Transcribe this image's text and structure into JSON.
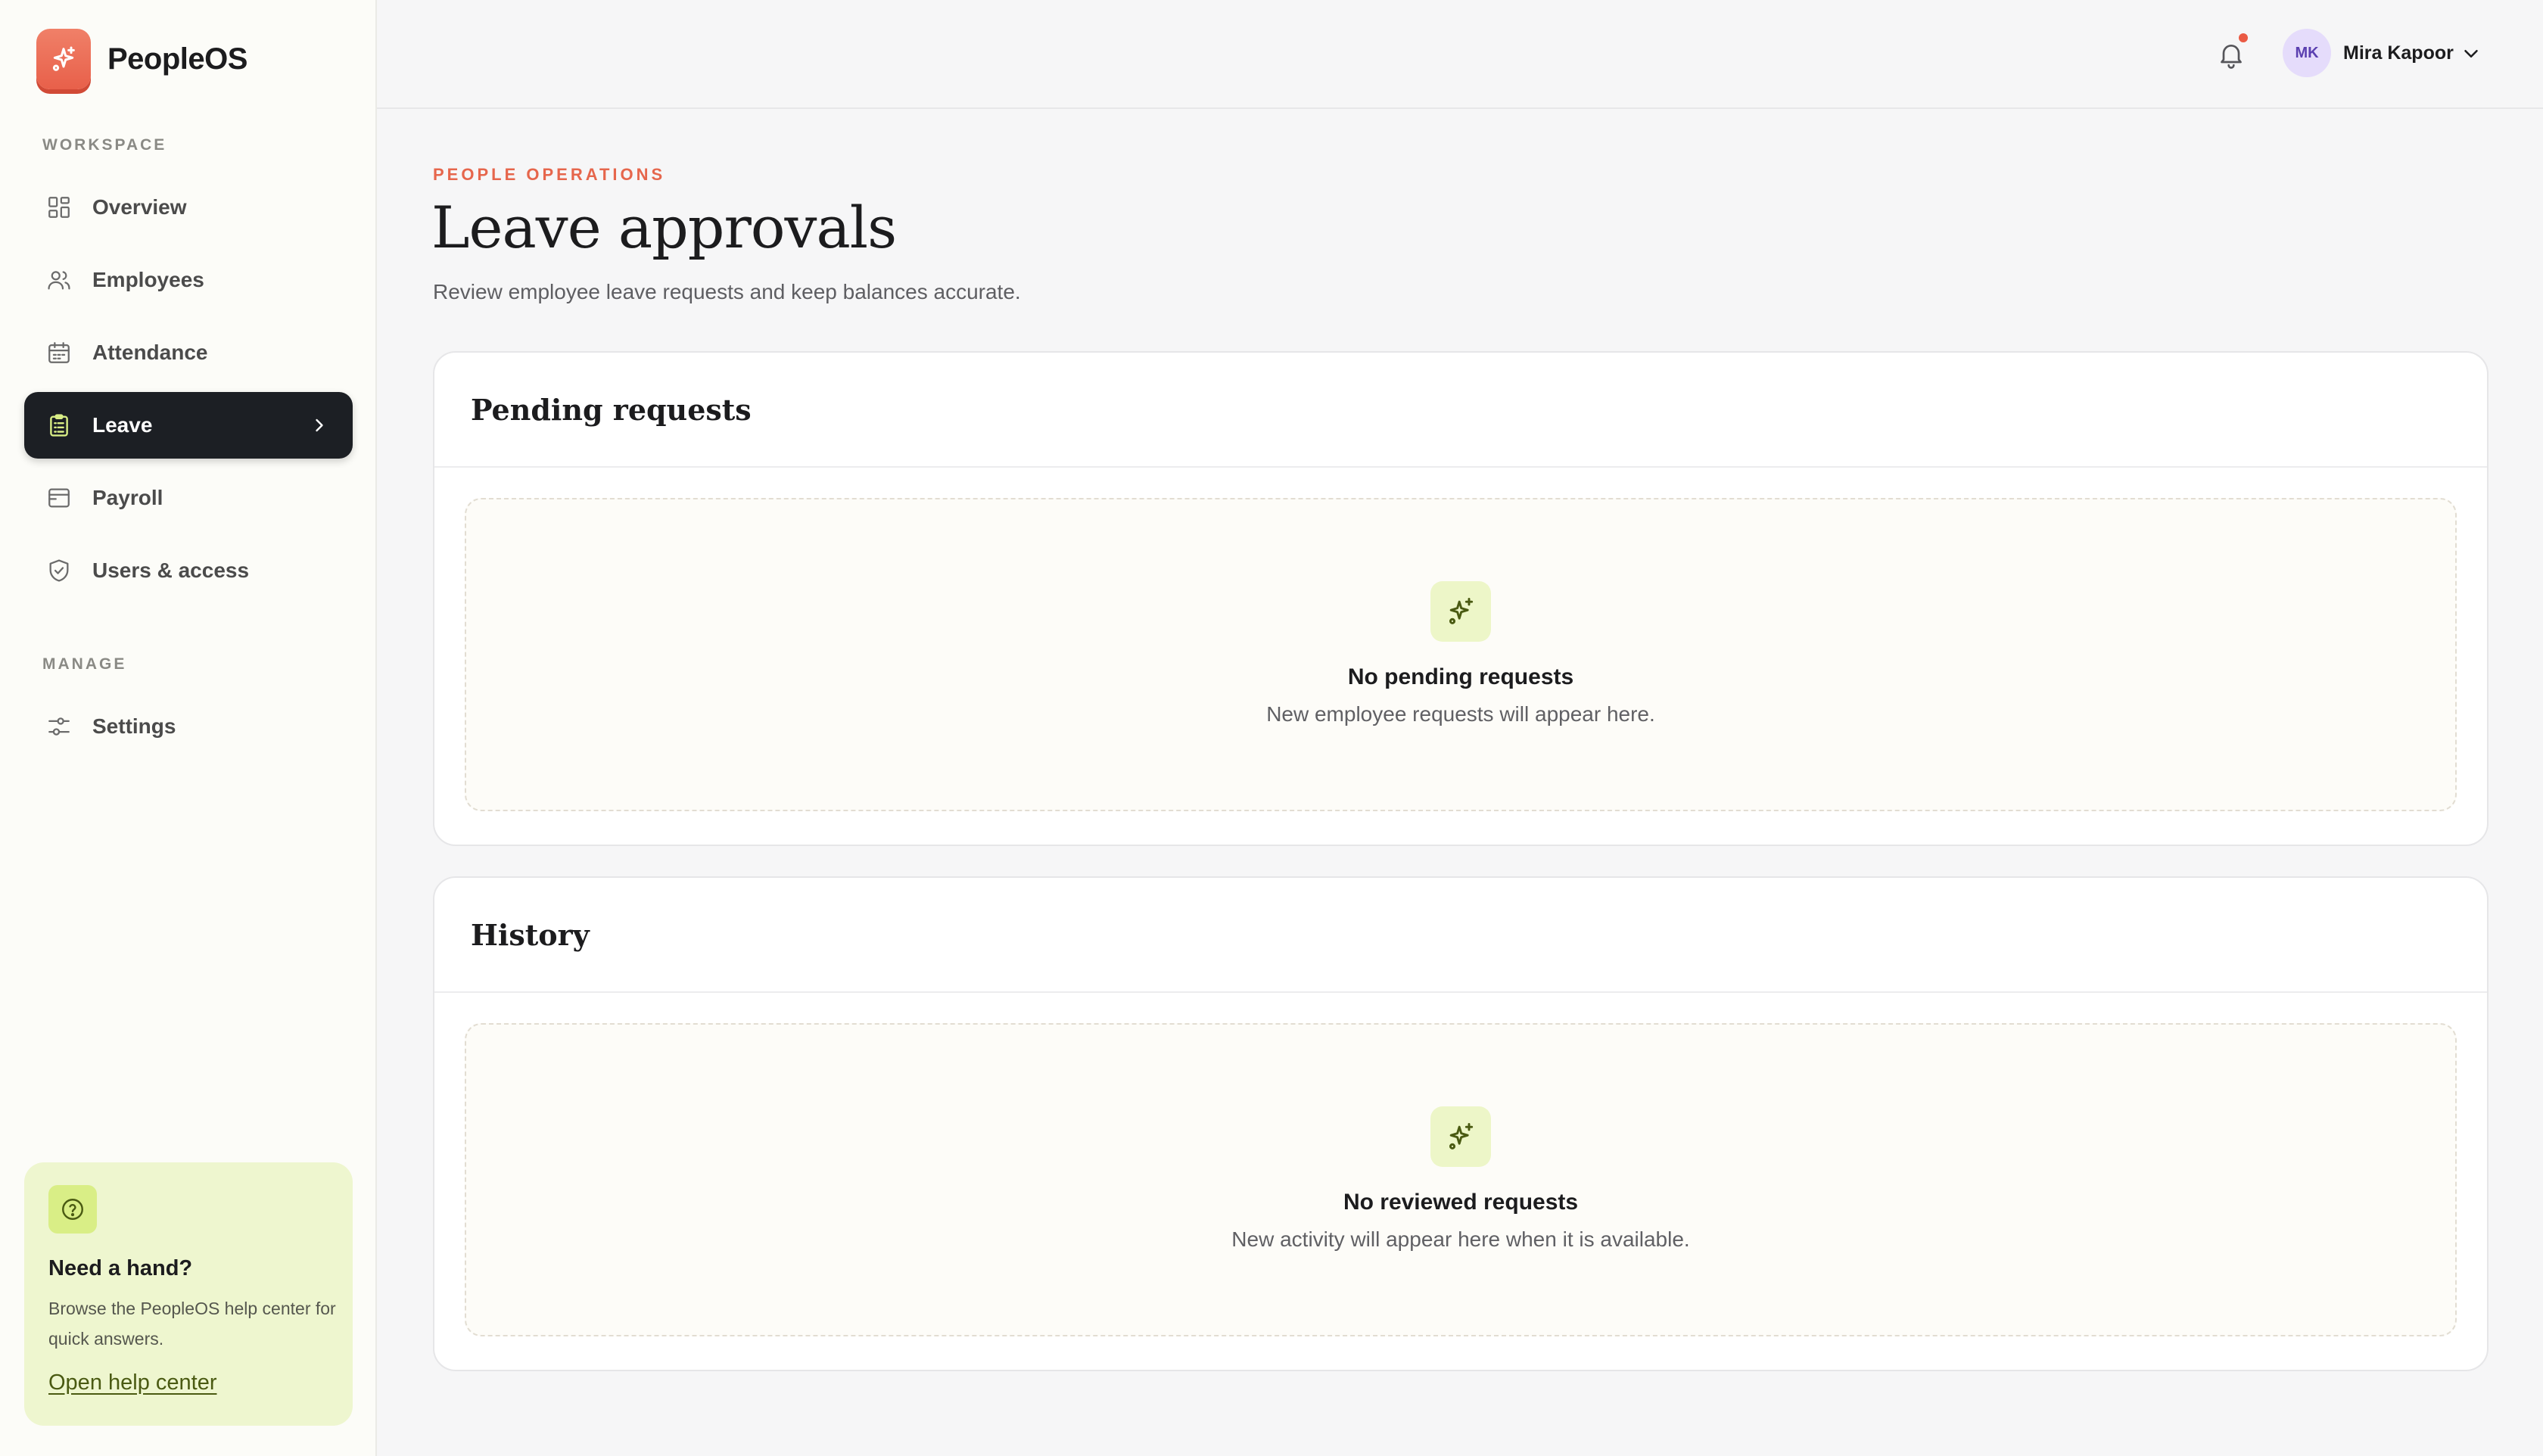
{
  "app": {
    "name": "PeopleOS",
    "logo_icon": "sparkle-icon"
  },
  "sidebar": {
    "sections": [
      {
        "label": "WORKSPACE"
      },
      {
        "label": "MANAGE"
      }
    ],
    "items": [
      {
        "label": "Overview",
        "icon": "grid-icon"
      },
      {
        "label": "Employees",
        "icon": "users-icon"
      },
      {
        "label": "Attendance",
        "icon": "calendar-icon"
      },
      {
        "label": "Leave",
        "icon": "clipboard-icon",
        "active": true
      },
      {
        "label": "Payroll",
        "icon": "wallet-icon"
      },
      {
        "label": "Users & access",
        "icon": "shield-icon"
      },
      {
        "label": "Settings",
        "icon": "sliders-icon"
      }
    ],
    "help": {
      "title": "Need a hand?",
      "text": "Browse the PeopleOS help center for quick answers.",
      "link": "Open help center"
    }
  },
  "topbar": {
    "user": {
      "initials": "MK",
      "name": "Mira Kapoor"
    },
    "has_notification": true
  },
  "page": {
    "eyebrow": "PEOPLE OPERATIONS",
    "title": "Leave approvals",
    "subtitle": "Review employee leave requests and keep balances accurate."
  },
  "panels": [
    {
      "title": "Pending requests",
      "empty_title": "No pending requests",
      "empty_text": "New employee requests will appear here."
    },
    {
      "title": "History",
      "empty_title": "No reviewed requests",
      "empty_text": "New activity will appear here when it is available."
    }
  ],
  "colors": {
    "accent": "#e6664c",
    "active_nav": "#1c1f24",
    "help_bg": "#eef6cf",
    "lime": "#d9ee86"
  }
}
